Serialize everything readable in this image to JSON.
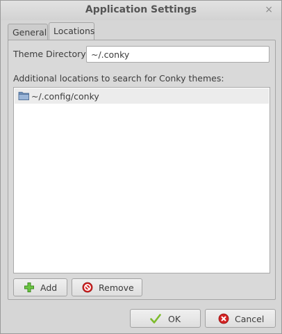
{
  "window": {
    "title": "Application Settings",
    "close_glyph": "×"
  },
  "tabs": [
    {
      "label": "General"
    },
    {
      "label": "Locations"
    }
  ],
  "active_tab": "Locations",
  "theme_directory": {
    "label": "Theme Directory",
    "value": "~/.conky"
  },
  "locations": {
    "label": "Additional locations to search for Conky themes:",
    "items": [
      {
        "icon": "folder-icon",
        "path": "~/.config/conky"
      }
    ]
  },
  "buttons": {
    "add": {
      "label": "Add",
      "icon": "plus-icon"
    },
    "remove": {
      "label": "Remove",
      "icon": "remove-icon"
    },
    "ok": {
      "label": "OK",
      "icon": "check-icon"
    },
    "cancel": {
      "label": "Cancel",
      "icon": "cancel-icon"
    }
  },
  "colors": {
    "window_bg": "#d6d6d6",
    "add_green": "#6cc644",
    "remove_red": "#d42323",
    "ok_green": "#7dbb2c"
  }
}
